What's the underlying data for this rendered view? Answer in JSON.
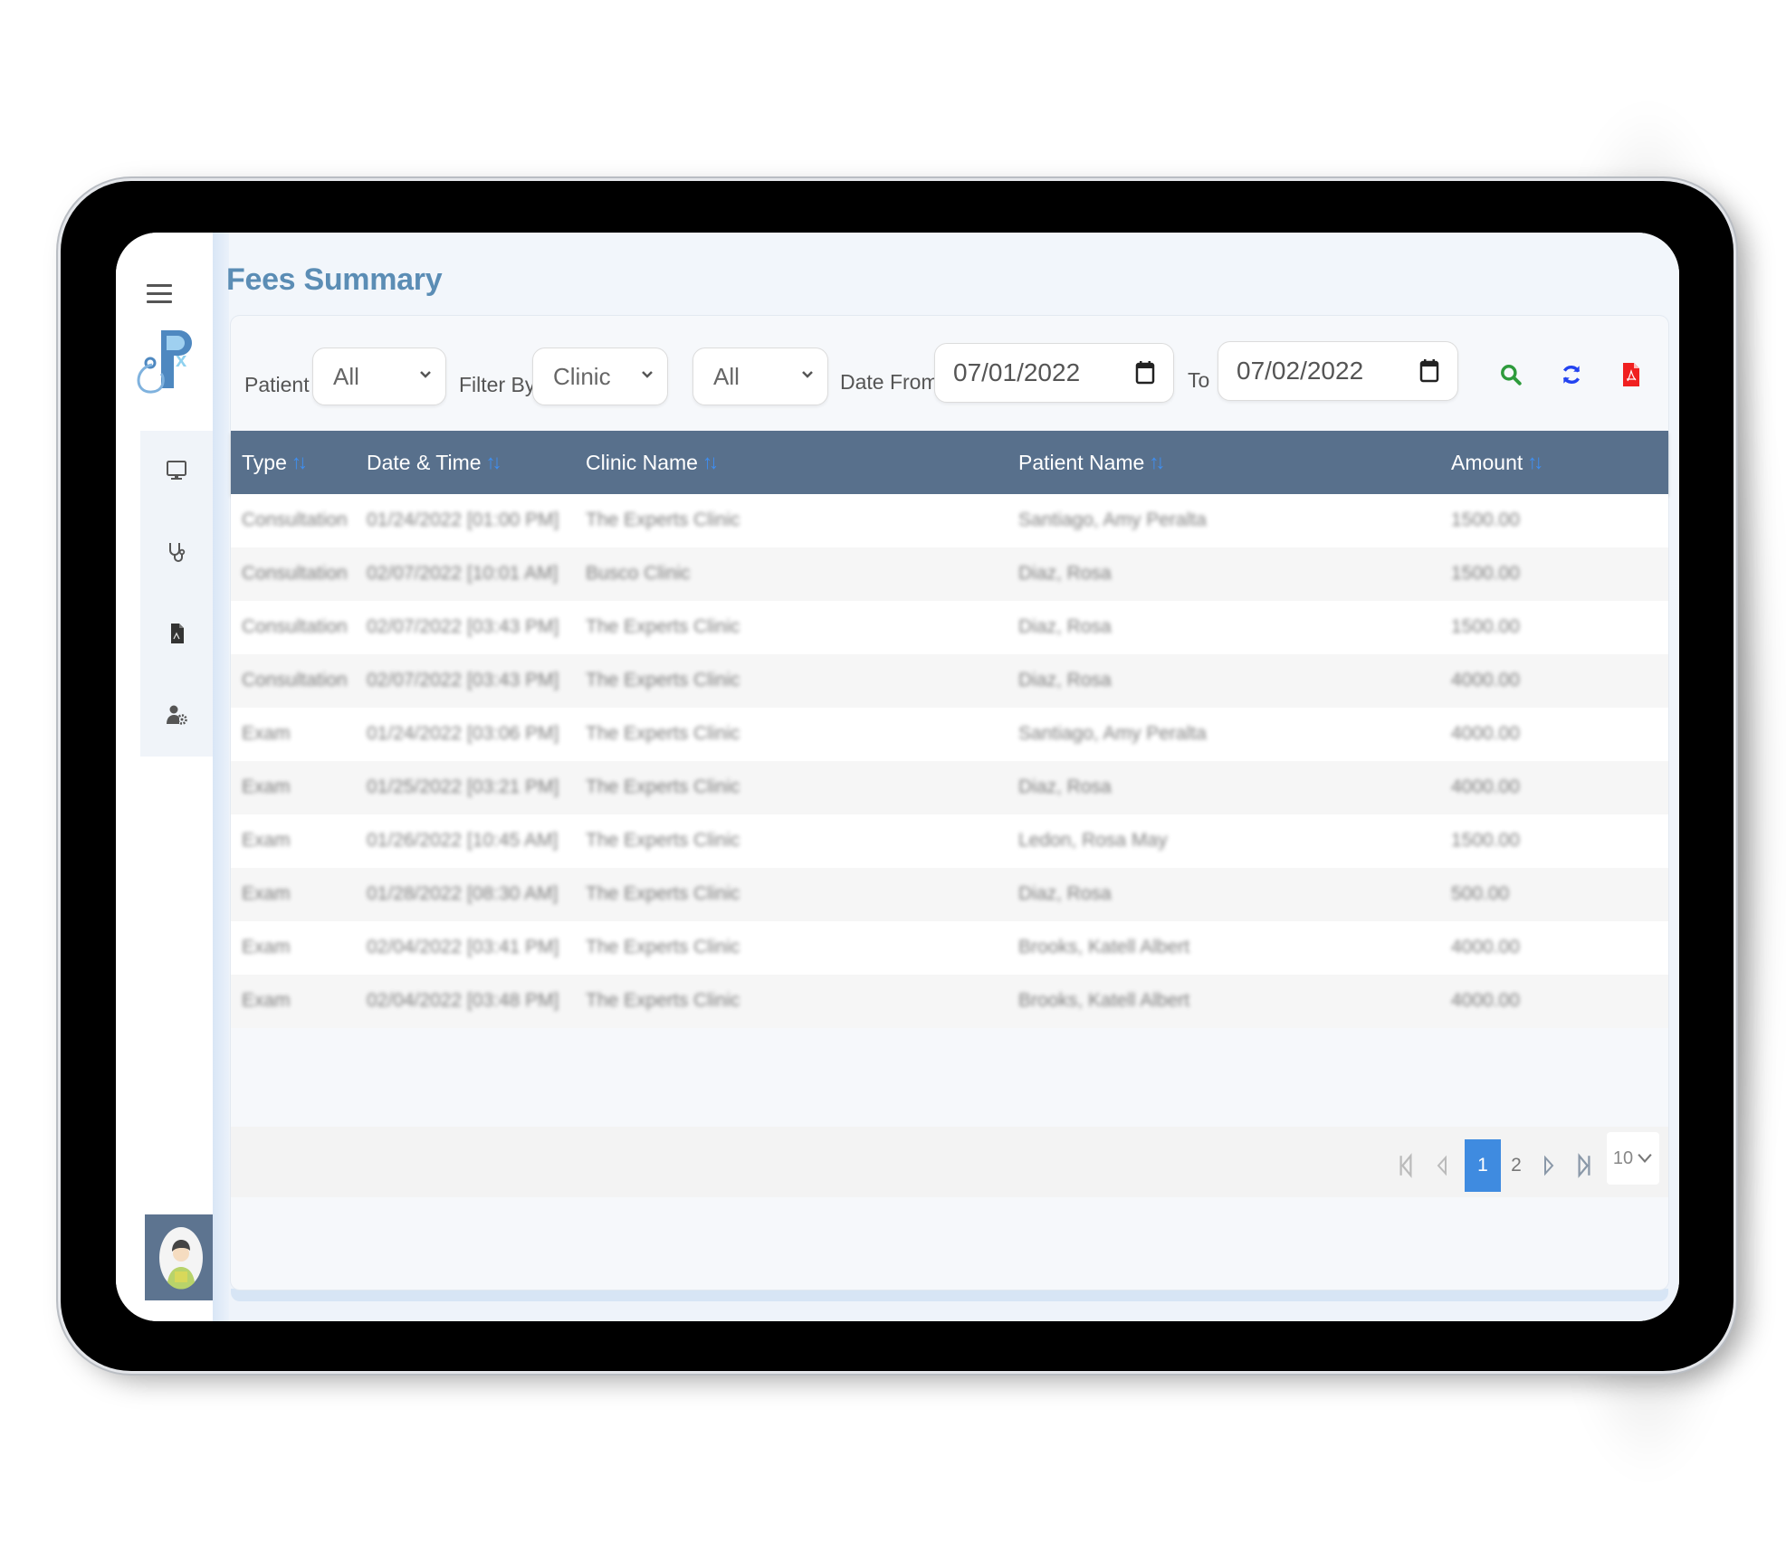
{
  "page": {
    "title": "Fees Summary"
  },
  "sidebar": {
    "menu_icon": "hamburger-icon",
    "logo_icon": "rx-stethoscope-logo-icon",
    "items": [
      {
        "name": "dashboard",
        "icon": "monitor-icon"
      },
      {
        "name": "clinical",
        "icon": "stethoscope-icon"
      },
      {
        "name": "documents",
        "icon": "pdf-document-icon"
      },
      {
        "name": "user-settings",
        "icon": "user-gear-icon"
      }
    ],
    "avatar_icon": "user-avatar-icon"
  },
  "filters": {
    "patient_label": "Patient",
    "patient_value": "All",
    "filter_by_label": "Filter By",
    "filter_by_value": "Clinic",
    "filter_value": "All",
    "date_from_label": "Date From",
    "date_from_value": "07/01/2022",
    "to_label": "To",
    "date_to_value": "07/02/2022",
    "actions": [
      {
        "name": "search",
        "icon": "search-icon",
        "color": "#2e9b3c"
      },
      {
        "name": "refresh",
        "icon": "refresh-icon",
        "color": "#2343f0"
      },
      {
        "name": "export-pdf",
        "icon": "pdf-icon",
        "color": "#f02020"
      }
    ]
  },
  "table": {
    "columns": [
      "Type",
      "Date & Time",
      "Clinic Name",
      "Patient Name",
      "Amount"
    ],
    "sort_icon": "sort-arrows-icon",
    "rows": [
      {
        "type": "Consultation",
        "datetime": "01/24/2022 [01:00 PM]",
        "clinic": "The Experts Clinic",
        "patient": "Santiago, Amy Peralta",
        "amount": "1500.00"
      },
      {
        "type": "Consultation",
        "datetime": "02/07/2022 [10:01 AM]",
        "clinic": "Busco Clinic",
        "patient": "Diaz, Rosa",
        "amount": "1500.00"
      },
      {
        "type": "Consultation",
        "datetime": "02/07/2022 [03:43 PM]",
        "clinic": "The Experts Clinic",
        "patient": "Diaz, Rosa",
        "amount": "1500.00"
      },
      {
        "type": "Consultation",
        "datetime": "02/07/2022 [03:43 PM]",
        "clinic": "The Experts Clinic",
        "patient": "Diaz, Rosa",
        "amount": "4000.00"
      },
      {
        "type": "Exam",
        "datetime": "01/24/2022 [03:06 PM]",
        "clinic": "The Experts Clinic",
        "patient": "Santiago, Amy Peralta",
        "amount": "4000.00"
      },
      {
        "type": "Exam",
        "datetime": "01/25/2022 [03:21 PM]",
        "clinic": "The Experts Clinic",
        "patient": "Diaz, Rosa",
        "amount": "4000.00"
      },
      {
        "type": "Exam",
        "datetime": "01/26/2022 [10:45 AM]",
        "clinic": "The Experts Clinic",
        "patient": "Ledon, Rosa May",
        "amount": "1500.00"
      },
      {
        "type": "Exam",
        "datetime": "01/28/2022 [08:30 AM]",
        "clinic": "The Experts Clinic",
        "patient": "Diaz, Rosa",
        "amount": "500.00"
      },
      {
        "type": "Exam",
        "datetime": "02/04/2022 [03:41 PM]",
        "clinic": "The Experts Clinic",
        "patient": "Brooks, Katell Albert",
        "amount": "4000.00"
      },
      {
        "type": "Exam",
        "datetime": "02/04/2022 [03:48 PM]",
        "clinic": "The Experts Clinic",
        "patient": "Brooks, Katell Albert",
        "amount": "4000.00"
      }
    ]
  },
  "pagination": {
    "pages": [
      "1",
      "2"
    ],
    "current_page": "1",
    "page_size": "10",
    "first_icon": "first-page-icon",
    "prev_icon": "prev-page-icon",
    "next_icon": "next-page-icon",
    "last_icon": "last-page-icon"
  }
}
